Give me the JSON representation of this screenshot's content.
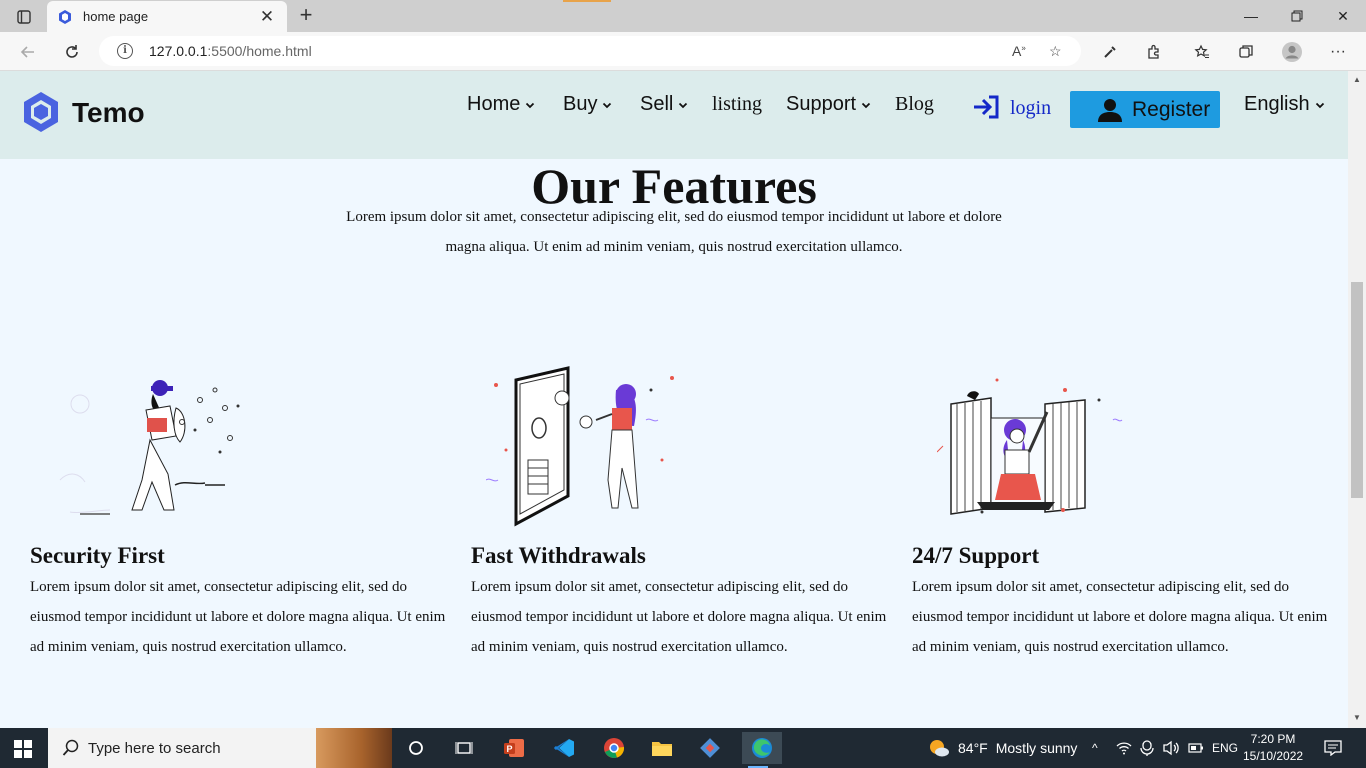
{
  "browser": {
    "tab_title": "home page",
    "url_host": "127.0.0.1",
    "url_rest": ":5500/home.html"
  },
  "header": {
    "logo_text": "Temo",
    "nav": [
      {
        "label": "Home",
        "has_dropdown": true
      },
      {
        "label": "Buy",
        "has_dropdown": true
      },
      {
        "label": "Sell",
        "has_dropdown": true
      },
      {
        "label": "listing",
        "has_dropdown": false
      },
      {
        "label": "Support",
        "has_dropdown": true
      },
      {
        "label": "Blog",
        "has_dropdown": false
      }
    ],
    "login_label": "login",
    "register_label": "Register",
    "language_label": "English",
    "accent_color": "#1e9be0",
    "login_color": "#1428c8"
  },
  "features": {
    "title": "Our Features",
    "description": "Lorem ipsum dolor sit amet, consectetur adipiscing elit, sed do eiusmod tempor incididunt ut labore et dolore magna aliqua. Ut enim ad minim veniam, quis nostrud exercitation ullamco.",
    "cards": [
      {
        "title": "Security First",
        "text": "Lorem ipsum dolor sit amet, consectetur adipiscing elit, sed do eiusmod tempor incididunt ut labore et dolore magna aliqua. Ut enim ad minim veniam, quis nostrud exercitation ullamco.",
        "illustration": "person-with-shield-illustration"
      },
      {
        "title": "Fast Withdrawals",
        "text": "Lorem ipsum dolor sit amet, consectetur adipiscing elit, sed do eiusmod tempor incididunt ut labore et dolore magna aliqua. Ut enim ad minim veniam, quis nostrud exercitation ullamco.",
        "illustration": "woman-with-phone-coins-illustration"
      },
      {
        "title": "24/7 Support",
        "text": "Lorem ipsum dolor sit amet, consectetur adipiscing elit, sed do eiusmod tempor incididunt ut labore et dolore magna aliqua. Ut enim ad minim veniam, quis nostrud exercitation ullamco.",
        "illustration": "woman-waving-window-illustration"
      }
    ]
  },
  "taskbar": {
    "search_placeholder": "Type here to search",
    "weather_temp": "84°F",
    "weather_text": "Mostly sunny",
    "language": "ENG",
    "time": "7:20 PM",
    "date": "15/10/2022"
  }
}
